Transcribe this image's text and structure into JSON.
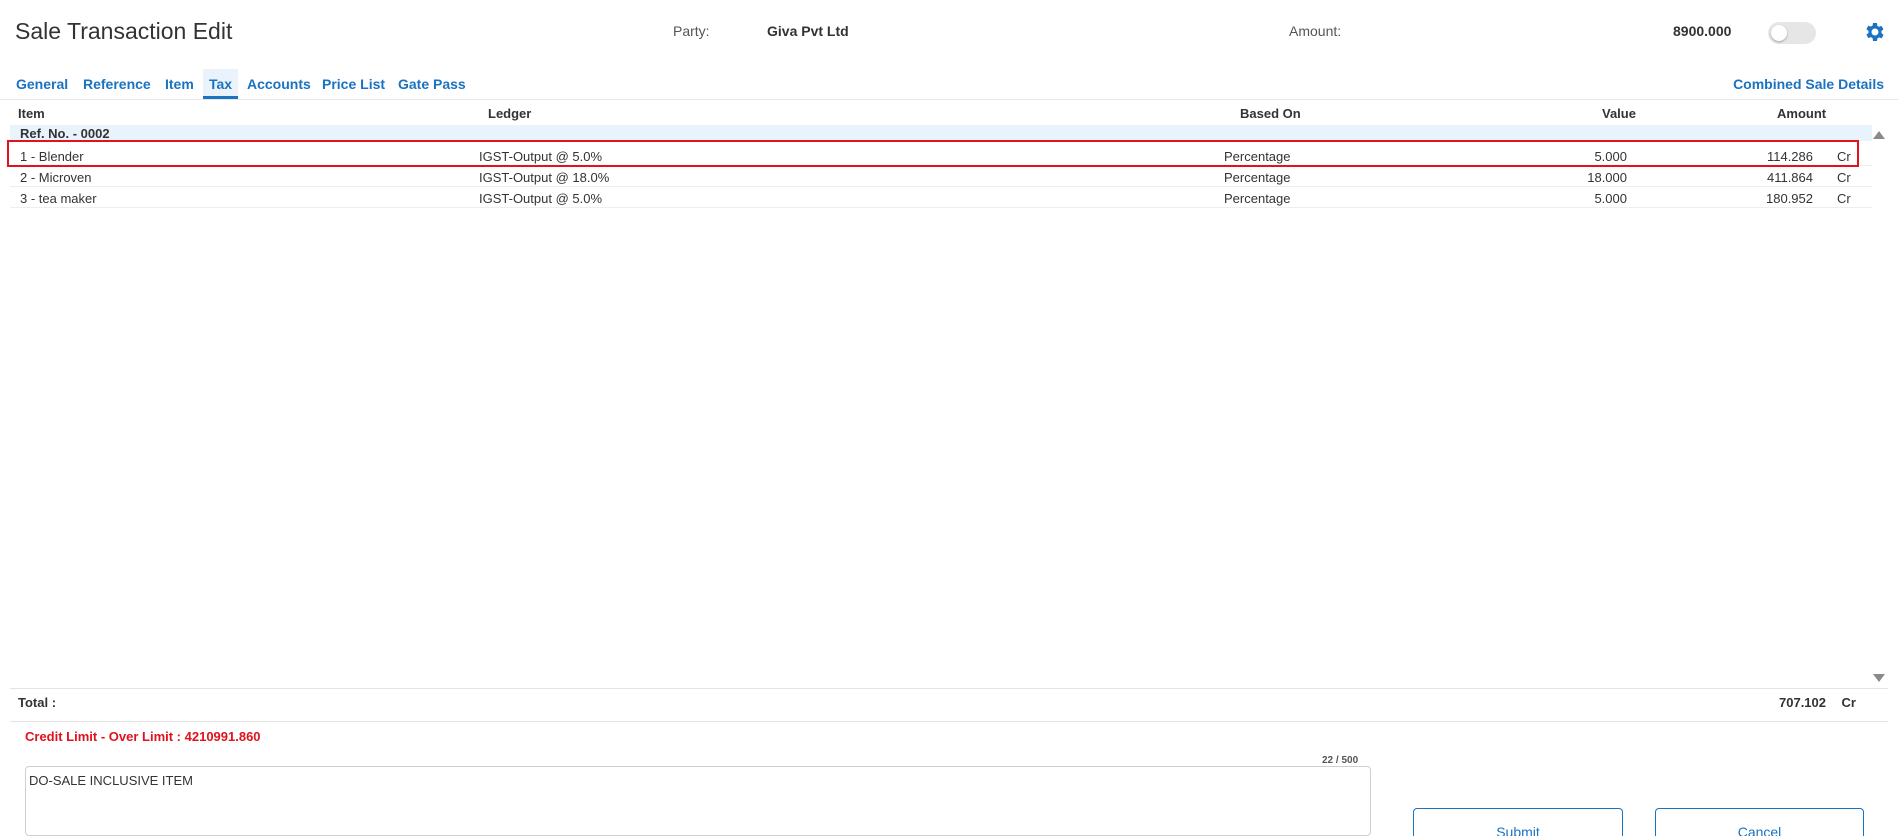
{
  "header": {
    "title": "Sale Transaction Edit",
    "party_label": "Party:",
    "party_value": "Giva Pvt Ltd",
    "amount_label": "Amount:",
    "amount_value": "8900.000"
  },
  "tabs": [
    {
      "label": "General"
    },
    {
      "label": "Reference"
    },
    {
      "label": "Item"
    },
    {
      "label": "Tax",
      "active": true
    },
    {
      "label": "Accounts"
    },
    {
      "label": "Price List"
    },
    {
      "label": "Gate Pass"
    }
  ],
  "combined_link": "Combined Sale Details",
  "table": {
    "headers": {
      "item": "Item",
      "ledger": "Ledger",
      "based_on": "Based On",
      "value": "Value",
      "amount": "Amount"
    },
    "group": "Ref. No. - 0002",
    "rows": [
      {
        "item": "1 - Blender",
        "ledger": "IGST-Output @ 5.0%",
        "based_on": "Percentage",
        "value": "5.000",
        "amount": "114.286",
        "drcr": "Cr"
      },
      {
        "item": "2 - Microven",
        "ledger": "IGST-Output @ 18.0%",
        "based_on": "Percentage",
        "value": "18.000",
        "amount": "411.864",
        "drcr": "Cr"
      },
      {
        "item": "3 - tea maker",
        "ledger": "IGST-Output @ 5.0%",
        "based_on": "Percentage",
        "value": "5.000",
        "amount": "180.952",
        "drcr": "Cr"
      }
    ]
  },
  "total": {
    "label": "Total :",
    "amount": "707.102",
    "drcr": "Cr"
  },
  "credit_limit": "Credit Limit - Over Limit : 4210991.860",
  "remarks": {
    "counter": "22 / 500",
    "value": "DO-SALE INCLUSIVE ITEM"
  },
  "buttons": {
    "submit": "Submit",
    "cancel": "Cancel"
  },
  "colors": {
    "accent": "#1a73c0",
    "alert": "#e0121d",
    "highlight_row_border": "#e0121d"
  },
  "icons": {
    "settings": "gear-icon",
    "scroll_up": "triangle-up-icon",
    "scroll_down": "triangle-down-icon"
  }
}
